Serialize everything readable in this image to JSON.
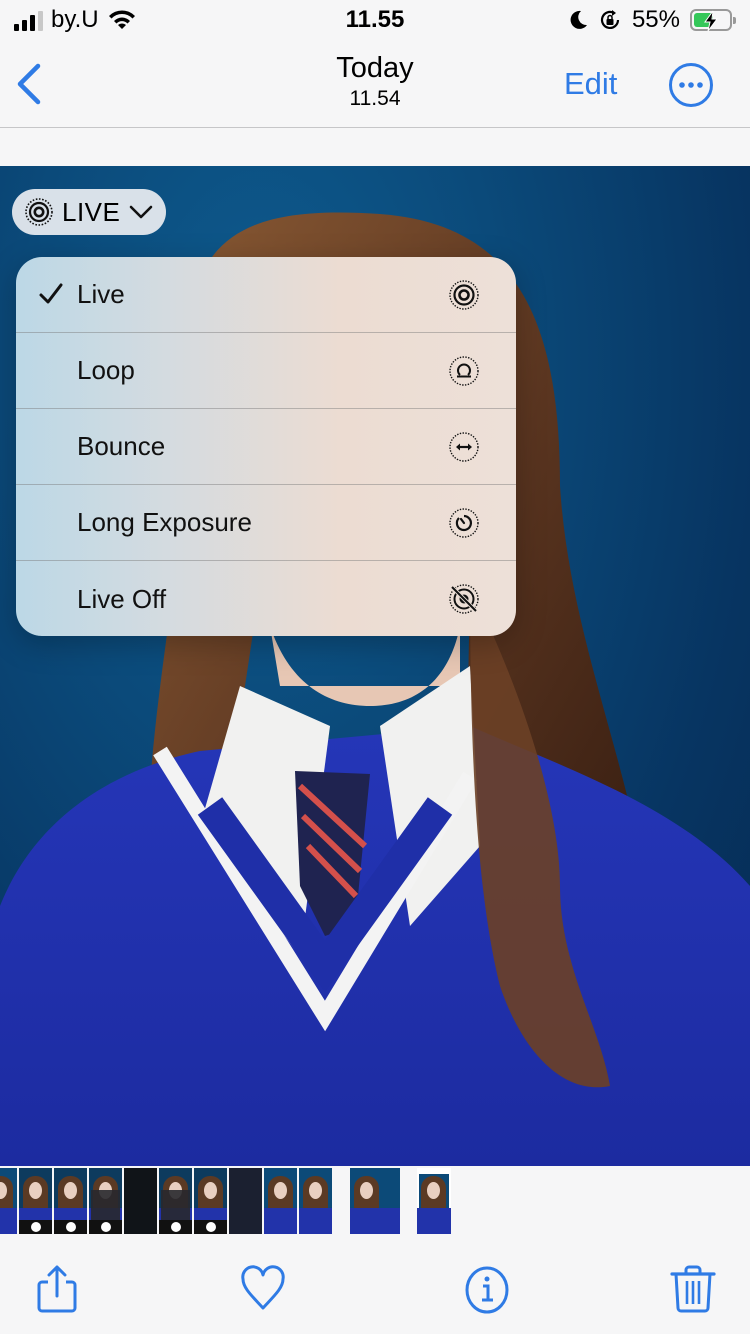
{
  "status_bar": {
    "carrier": "by.U",
    "time": "11.55",
    "battery_percent": "55%",
    "battery_level": 0.55,
    "icons": [
      "signal-icon",
      "wifi-icon",
      "moon-icon",
      "rotation-lock-icon",
      "battery-charging-icon"
    ]
  },
  "nav": {
    "title": "Today",
    "subtitle": "11.54",
    "edit_label": "Edit",
    "back_icon": "chevron-left-icon",
    "more_icon": "ellipsis-circle-icon"
  },
  "live_button": {
    "label": "LIVE",
    "icon": "live-photo-icon",
    "chevron": "chevron-down-icon"
  },
  "live_menu": {
    "items": [
      {
        "label": "Live",
        "selected": true,
        "icon": "live-photo-icon"
      },
      {
        "label": "Loop",
        "selected": false,
        "icon": "loop-icon"
      },
      {
        "label": "Bounce",
        "selected": false,
        "icon": "bounce-icon"
      },
      {
        "label": "Long Exposure",
        "selected": false,
        "icon": "long-exposure-icon"
      },
      {
        "label": "Live Off",
        "selected": false,
        "icon": "live-off-icon"
      }
    ]
  },
  "thumbnail_strip": {
    "count": 12
  },
  "toolbar": {
    "items": [
      {
        "name": "share",
        "icon": "share-icon"
      },
      {
        "name": "favorite",
        "icon": "heart-icon"
      },
      {
        "name": "info",
        "icon": "info-icon"
      },
      {
        "name": "delete",
        "icon": "trash-icon"
      }
    ]
  },
  "colors": {
    "accent": "#2f7be5",
    "bar_background": "#f6f6f7",
    "battery_green": "#34c759"
  }
}
